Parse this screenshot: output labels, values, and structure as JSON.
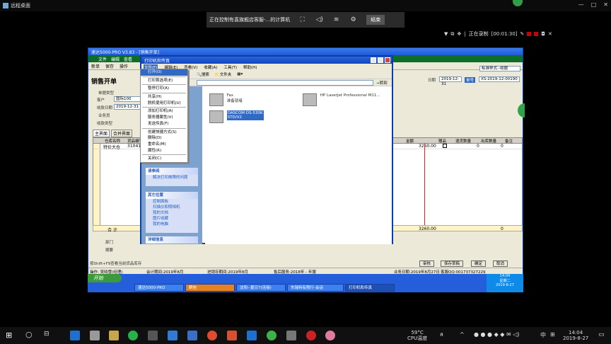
{
  "remote_desktop": {
    "title": "远程桌面",
    "connection_bar": {
      "session": "正在控制有喜旗舰店客服-...的计算机",
      "end_button": "结束"
    },
    "recording": {
      "status": "正在录制",
      "time": "[00:01:30]"
    }
  },
  "app": {
    "title": "速达5000-PRO V3.83 - [销售开单]",
    "menu": [
      "文件",
      "编辑",
      "查看",
      "收藏",
      "工具",
      "帮助"
    ],
    "toolbar": [
      "新单",
      "保存",
      "操作",
      "打印",
      "打印",
      "退出"
    ],
    "doc_title": "销售开单",
    "fields": {
      "sale_type_label": "单据类型",
      "doc_no_label": "单号",
      "doc_no_value": "XS-2019-12-00190",
      "customer_label": "客户",
      "customer_value": "国际100",
      "date_label": "收款日期",
      "date_value": "2019-12-31",
      "clerk_label": "业务员",
      "doc_date_label": "日期",
      "doc_date_value": "2019-12-31",
      "receive_type_label": "收款类型",
      "print_template": "标准样式--收据"
    },
    "tabs": [
      "主界面",
      "合并界面"
    ],
    "grid": {
      "headers": [
        "仓库名称",
        "货品编号",
        "金额",
        "赠品",
        "退货数量",
        "出库数量",
        "备注"
      ],
      "rows": [
        [
          "特价大仓",
          "31041",
          "3260.00",
          "",
          "0",
          "0",
          ""
        ]
      ],
      "sum_label": "合  计",
      "sum_amount": "3260.00",
      "sum_qty": "0"
    },
    "bottom": {
      "dept_label": "部门",
      "note_label": "摘要",
      "buttons": [
        "审核",
        "保存草稿",
        "确定",
        "取消"
      ]
    },
    "status": {
      "hint": "按Shift+F9查看当前货品库存",
      "user": "操作: 吴晓雪(经理)",
      "period": "会计期间:2019年8月",
      "stock_period": "进销存期间:2019年8月",
      "service": "售后服务:2018年 - 年服",
      "expiry": "业务日期:2019年8月27日",
      "tel": "客服QQ:001737327229"
    }
  },
  "printers_window": {
    "title": "打印机和传真",
    "menu": [
      "文件(F)",
      "编辑(E)",
      "查看(V)",
      "收藏(A)",
      "工具(T)",
      "帮助(H)"
    ],
    "toolbar": [
      "搜索",
      "文件夹"
    ],
    "go_label": "转到",
    "printers": [
      {
        "name": "Fax",
        "status": "准备就绪"
      },
      {
        "name": "HP LaserJet Professional M11...",
        "status": ""
      },
      {
        "name": "DASCOM DS-530K",
        "status": "STD/V2"
      }
    ],
    "side": {
      "see_also_title": "请参阅",
      "see_also_items": [
        "解决打印故障的问题"
      ],
      "other_title": "其它位置",
      "other_items": [
        "控制面板",
        "扫描仪和照相机",
        "我的文档",
        "图片收藏",
        "我的电脑"
      ],
      "details_title": "详细信息"
    }
  },
  "file_menu": {
    "items": [
      "打开(O)",
      "打印首选项(E)",
      "暂停打印(A)",
      "共享(H)",
      "脱机使用打印机(U)",
      "添加打印机(A)",
      "服务器属性(V)",
      "发送传真(F)",
      "创建快捷方式(S)",
      "删除(D)",
      "重命名(M)",
      "属性(R)",
      "关闭(C)"
    ],
    "selected_index": 0
  },
  "remote_taskbar": {
    "start": "开始",
    "tasks": [
      "速达5000-PRO",
      "群信",
      "沈阳--夏日7(连接)",
      "东瑞特有限行-会话",
      "打印机和传真"
    ],
    "clock": "14:04",
    "date": "星期二",
    "date_full": "2019-8-27"
  },
  "host_taskbar": {
    "temp": "59°C",
    "temp_label": "CPU温度",
    "ime": "中",
    "time": "14:04",
    "date": "2019-8-27"
  }
}
